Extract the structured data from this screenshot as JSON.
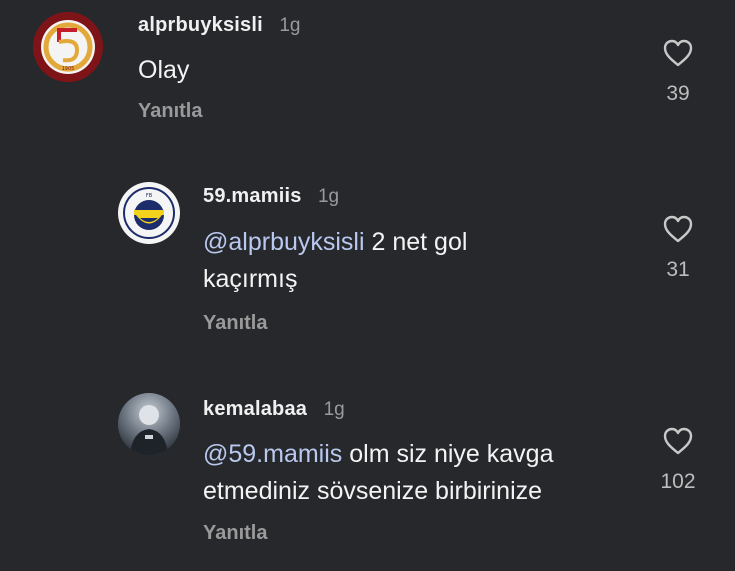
{
  "comments": [
    {
      "username": "alprbuyksisli",
      "time": "1g",
      "mention": "",
      "text": "Olay",
      "reply_label": "Yanıtla",
      "likes": "39",
      "avatar_icon": "galatasaray-logo-icon"
    },
    {
      "username": "59.mamiis",
      "time": "1g",
      "mention": "@alprbuyksisli",
      "text": " 2 net gol",
      "text2": "kaçırmış",
      "reply_label": "Yanıtla",
      "likes": "31",
      "avatar_icon": "fenerbahce-logo-icon"
    },
    {
      "username": "kemalabaa",
      "time": "1g",
      "mention": "@59.mamiis",
      "text": " olm siz niye kavga",
      "text2": "etmediniz sövsenize birbirinize",
      "reply_label": "Yanıtla",
      "likes": "102",
      "avatar_icon": "user-photo-avatar"
    }
  ],
  "colors": {
    "background": "#26282b",
    "mention": "#b9c8ee",
    "muted": "#9a9a9a"
  }
}
